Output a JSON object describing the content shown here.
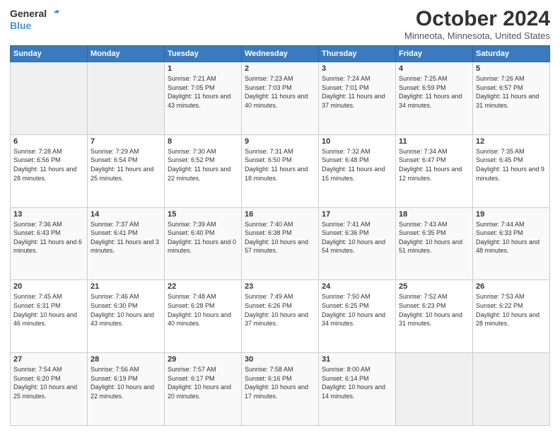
{
  "logo": {
    "line1": "General",
    "line2": "Blue"
  },
  "title": "October 2024",
  "subtitle": "Minneota, Minnesota, United States",
  "days_header": [
    "Sunday",
    "Monday",
    "Tuesday",
    "Wednesday",
    "Thursday",
    "Friday",
    "Saturday"
  ],
  "weeks": [
    [
      {
        "day": "",
        "info": ""
      },
      {
        "day": "",
        "info": ""
      },
      {
        "day": "1",
        "info": "Sunrise: 7:21 AM\nSunset: 7:05 PM\nDaylight: 11 hours\nand 43 minutes."
      },
      {
        "day": "2",
        "info": "Sunrise: 7:23 AM\nSunset: 7:03 PM\nDaylight: 11 hours\nand 40 minutes."
      },
      {
        "day": "3",
        "info": "Sunrise: 7:24 AM\nSunset: 7:01 PM\nDaylight: 11 hours\nand 37 minutes."
      },
      {
        "day": "4",
        "info": "Sunrise: 7:25 AM\nSunset: 6:59 PM\nDaylight: 11 hours\nand 34 minutes."
      },
      {
        "day": "5",
        "info": "Sunrise: 7:26 AM\nSunset: 6:57 PM\nDaylight: 11 hours\nand 31 minutes."
      }
    ],
    [
      {
        "day": "6",
        "info": "Sunrise: 7:28 AM\nSunset: 6:56 PM\nDaylight: 11 hours\nand 28 minutes."
      },
      {
        "day": "7",
        "info": "Sunrise: 7:29 AM\nSunset: 6:54 PM\nDaylight: 11 hours\nand 25 minutes."
      },
      {
        "day": "8",
        "info": "Sunrise: 7:30 AM\nSunset: 6:52 PM\nDaylight: 11 hours\nand 22 minutes."
      },
      {
        "day": "9",
        "info": "Sunrise: 7:31 AM\nSunset: 6:50 PM\nDaylight: 11 hours\nand 18 minutes."
      },
      {
        "day": "10",
        "info": "Sunrise: 7:32 AM\nSunset: 6:48 PM\nDaylight: 11 hours\nand 15 minutes."
      },
      {
        "day": "11",
        "info": "Sunrise: 7:34 AM\nSunset: 6:47 PM\nDaylight: 11 hours\nand 12 minutes."
      },
      {
        "day": "12",
        "info": "Sunrise: 7:35 AM\nSunset: 6:45 PM\nDaylight: 11 hours\nand 9 minutes."
      }
    ],
    [
      {
        "day": "13",
        "info": "Sunrise: 7:36 AM\nSunset: 6:43 PM\nDaylight: 11 hours\nand 6 minutes."
      },
      {
        "day": "14",
        "info": "Sunrise: 7:37 AM\nSunset: 6:41 PM\nDaylight: 11 hours\nand 3 minutes."
      },
      {
        "day": "15",
        "info": "Sunrise: 7:39 AM\nSunset: 6:40 PM\nDaylight: 11 hours\nand 0 minutes."
      },
      {
        "day": "16",
        "info": "Sunrise: 7:40 AM\nSunset: 6:38 PM\nDaylight: 10 hours\nand 57 minutes."
      },
      {
        "day": "17",
        "info": "Sunrise: 7:41 AM\nSunset: 6:36 PM\nDaylight: 10 hours\nand 54 minutes."
      },
      {
        "day": "18",
        "info": "Sunrise: 7:43 AM\nSunset: 6:35 PM\nDaylight: 10 hours\nand 51 minutes."
      },
      {
        "day": "19",
        "info": "Sunrise: 7:44 AM\nSunset: 6:33 PM\nDaylight: 10 hours\nand 48 minutes."
      }
    ],
    [
      {
        "day": "20",
        "info": "Sunrise: 7:45 AM\nSunset: 6:31 PM\nDaylight: 10 hours\nand 46 minutes."
      },
      {
        "day": "21",
        "info": "Sunrise: 7:46 AM\nSunset: 6:30 PM\nDaylight: 10 hours\nand 43 minutes."
      },
      {
        "day": "22",
        "info": "Sunrise: 7:48 AM\nSunset: 6:28 PM\nDaylight: 10 hours\nand 40 minutes."
      },
      {
        "day": "23",
        "info": "Sunrise: 7:49 AM\nSunset: 6:26 PM\nDaylight: 10 hours\nand 37 minutes."
      },
      {
        "day": "24",
        "info": "Sunrise: 7:50 AM\nSunset: 6:25 PM\nDaylight: 10 hours\nand 34 minutes."
      },
      {
        "day": "25",
        "info": "Sunrise: 7:52 AM\nSunset: 6:23 PM\nDaylight: 10 hours\nand 31 minutes."
      },
      {
        "day": "26",
        "info": "Sunrise: 7:53 AM\nSunset: 6:22 PM\nDaylight: 10 hours\nand 28 minutes."
      }
    ],
    [
      {
        "day": "27",
        "info": "Sunrise: 7:54 AM\nSunset: 6:20 PM\nDaylight: 10 hours\nand 25 minutes."
      },
      {
        "day": "28",
        "info": "Sunrise: 7:56 AM\nSunset: 6:19 PM\nDaylight: 10 hours\nand 22 minutes."
      },
      {
        "day": "29",
        "info": "Sunrise: 7:57 AM\nSunset: 6:17 PM\nDaylight: 10 hours\nand 20 minutes."
      },
      {
        "day": "30",
        "info": "Sunrise: 7:58 AM\nSunset: 6:16 PM\nDaylight: 10 hours\nand 17 minutes."
      },
      {
        "day": "31",
        "info": "Sunrise: 8:00 AM\nSunset: 6:14 PM\nDaylight: 10 hours\nand 14 minutes."
      },
      {
        "day": "",
        "info": ""
      },
      {
        "day": "",
        "info": ""
      }
    ]
  ]
}
